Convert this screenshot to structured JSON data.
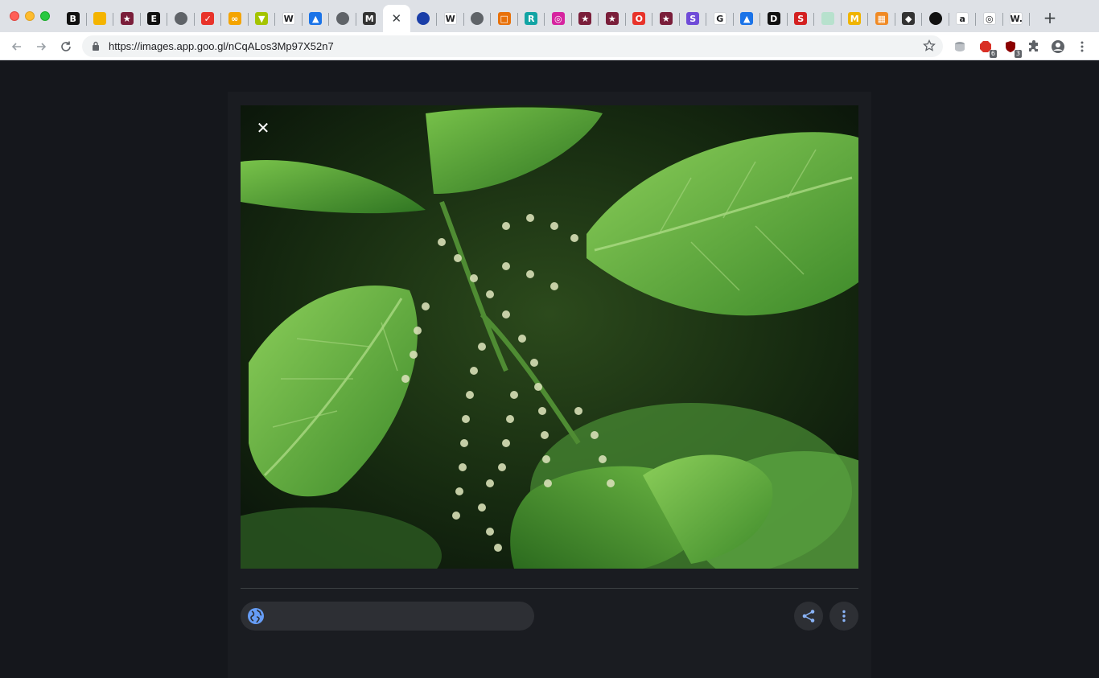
{
  "browser": {
    "address_bar": {
      "url": "https://images.app.goo.gl/nCqALos3Mp97X52n7"
    },
    "tabs": [
      {
        "icon": "booking-icon",
        "glyph": "B",
        "color": "#111111"
      },
      {
        "icon": "slides-icon",
        "glyph": "",
        "color": "#f4b400"
      },
      {
        "icon": "app-icon",
        "glyph": "★",
        "color": "#7a1e3a"
      },
      {
        "icon": "letter-e-icon",
        "glyph": "E",
        "color": "#111111"
      },
      {
        "icon": "globe-icon",
        "glyph": "",
        "color": "#5f6368"
      },
      {
        "icon": "red-app-icon",
        "glyph": "✓",
        "color": "#e8332a"
      },
      {
        "icon": "infinity-icon",
        "glyph": "∞",
        "color": "#f4a400"
      },
      {
        "icon": "green-app-icon",
        "glyph": "▼",
        "color": "#a4c400"
      },
      {
        "icon": "wikipedia-icon",
        "glyph": "W",
        "color": "#ffffff"
      },
      {
        "icon": "drive-icon",
        "glyph": "▲",
        "color": "#1a73e8"
      },
      {
        "icon": "globe-icon",
        "glyph": "",
        "color": "#5f6368"
      },
      {
        "icon": "medium-icon",
        "glyph": "M",
        "color": "#333333"
      },
      {
        "icon": "close-icon",
        "glyph": "✕",
        "color": "#ffffff",
        "active": true
      },
      {
        "icon": "blue-dot-icon",
        "glyph": "",
        "color": "#1a3ea8"
      },
      {
        "icon": "wikipedia-icon",
        "glyph": "W",
        "color": "#ffffff"
      },
      {
        "icon": "globe-icon",
        "glyph": "",
        "color": "#5f6368"
      },
      {
        "icon": "book-icon",
        "glyph": "□",
        "color": "#e8710a"
      },
      {
        "icon": "r-icon",
        "glyph": "R",
        "color": "#12a4a4"
      },
      {
        "icon": "instagram-icon",
        "glyph": "◎",
        "color": "#d6249f"
      },
      {
        "icon": "app-icon",
        "glyph": "★",
        "color": "#7a1e3a"
      },
      {
        "icon": "app-icon",
        "glyph": "★",
        "color": "#7a1e3a"
      },
      {
        "icon": "opera-icon",
        "glyph": "O",
        "color": "#e8332a"
      },
      {
        "icon": "app-icon",
        "glyph": "★",
        "color": "#7a1e3a"
      },
      {
        "icon": "s-icon",
        "glyph": "S",
        "color": "#6f4bd8"
      },
      {
        "icon": "google-icon",
        "glyph": "G",
        "color": "#ffffff"
      },
      {
        "icon": "drive-icon",
        "glyph": "▲",
        "color": "#1a73e8"
      },
      {
        "icon": "d-icon",
        "glyph": "D",
        "color": "#111111"
      },
      {
        "icon": "s-red-icon",
        "glyph": "S",
        "color": "#d32020"
      },
      {
        "icon": "sheets-icon",
        "glyph": "",
        "color": "#b7e1cd"
      },
      {
        "icon": "m-yellow-icon",
        "glyph": "M",
        "color": "#f0b400"
      },
      {
        "icon": "orange-app-icon",
        "glyph": "▦",
        "color": "#f08a24"
      },
      {
        "icon": "diamond-icon",
        "glyph": "◆",
        "color": "#333333"
      },
      {
        "icon": "black-circle-icon",
        "glyph": "",
        "color": "#111111"
      },
      {
        "icon": "amazon-icon",
        "glyph": "a",
        "color": "#ffffff"
      },
      {
        "icon": "target-icon",
        "glyph": "◎",
        "color": "#ffffff"
      },
      {
        "icon": "w-icon",
        "glyph": "W.",
        "color": "#ffffff"
      }
    ],
    "new_tab_label": "+",
    "extensions": [
      {
        "icon": "db-extension-icon"
      },
      {
        "icon": "adblock-extension-icon",
        "badge": "6"
      },
      {
        "icon": "ublock-extension-icon",
        "badge": "3"
      },
      {
        "icon": "puzzle-extension-icon"
      },
      {
        "icon": "profile-icon"
      },
      {
        "icon": "menu-dots-icon"
      }
    ]
  },
  "viewer": {
    "close_label": "✕",
    "colors": {
      "background": "#15171c",
      "card": "#1a1c21",
      "pill": "#2d2f34",
      "accent": "#669df6"
    }
  }
}
